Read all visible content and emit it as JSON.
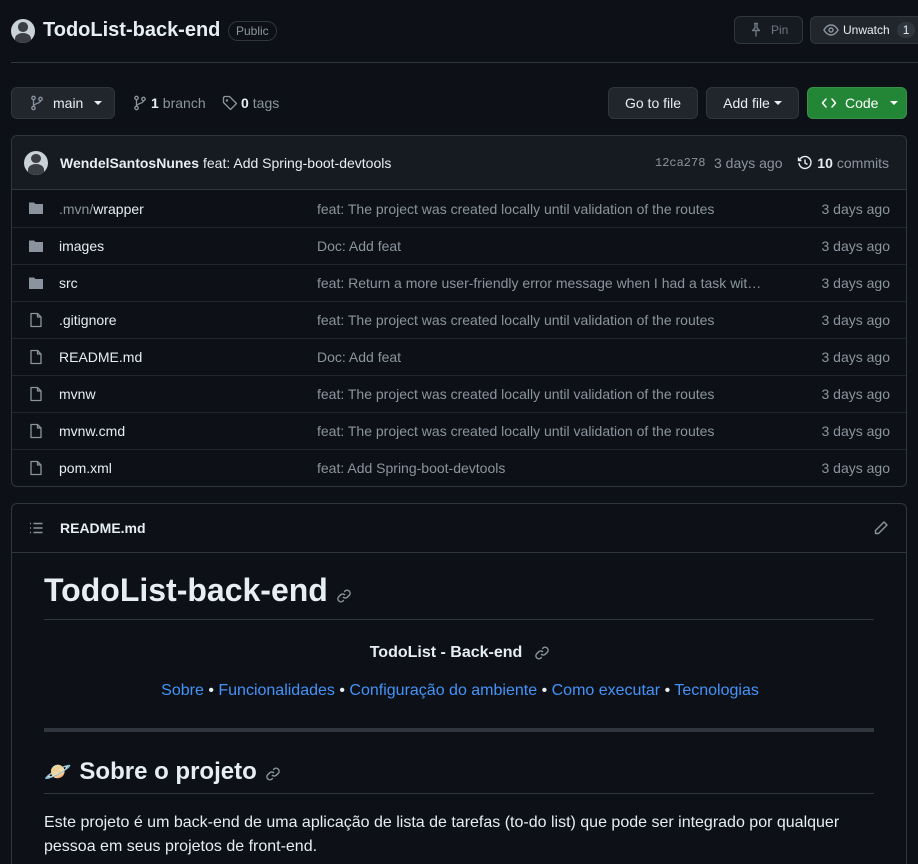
{
  "header": {
    "repo_name": "TodoList-back-end",
    "visibility": "Public",
    "pin_label": "Pin",
    "unwatch_label": "Unwatch",
    "watch_count": "1"
  },
  "toolbar": {
    "branch": "main",
    "branch_count": "1",
    "branch_label": "branch",
    "tag_count": "0",
    "tag_label": "tags",
    "go_to_file": "Go to file",
    "add_file": "Add file",
    "code": "Code"
  },
  "commit": {
    "author": "WendelSantosNunes",
    "message": "feat: Add Spring-boot-devtools",
    "sha": "12ca278",
    "age": "3 days ago",
    "commit_count": "10",
    "commits_label": "commits"
  },
  "files": [
    {
      "prefix": ".mvn/",
      "name": "wrapper",
      "type": "folder",
      "message": "feat: The project was created locally until validation of the routes",
      "age": "3 days ago"
    },
    {
      "prefix": "",
      "name": "images",
      "type": "folder",
      "message": "Doc: Add feat",
      "age": "3 days ago"
    },
    {
      "prefix": "",
      "name": "src",
      "type": "folder",
      "message": "feat: Return a more user-friendly error message when I had a task wit…",
      "age": "3 days ago"
    },
    {
      "prefix": "",
      "name": ".gitignore",
      "type": "file",
      "message": "feat: The project was created locally until validation of the routes",
      "age": "3 days ago"
    },
    {
      "prefix": "",
      "name": "README.md",
      "type": "file",
      "message": "Doc: Add feat",
      "age": "3 days ago"
    },
    {
      "prefix": "",
      "name": "mvnw",
      "type": "file",
      "message": "feat: The project was created locally until validation of the routes",
      "age": "3 days ago"
    },
    {
      "prefix": "",
      "name": "mvnw.cmd",
      "type": "file",
      "message": "feat: The project was created locally until validation of the routes",
      "age": "3 days ago"
    },
    {
      "prefix": "",
      "name": "pom.xml",
      "type": "file",
      "message": "feat: Add Spring-boot-devtools",
      "age": "3 days ago"
    }
  ],
  "readme": {
    "filename": "README.md",
    "title": "TodoList-back-end",
    "subtitle": "TodoList - Back-end",
    "nav_links": [
      "Sobre",
      "Funcionalidades",
      "Configuração do ambiente",
      "Como executar",
      "Tecnologias"
    ],
    "nav_separator": "•",
    "section_emoji": "🪐",
    "section_title": "Sobre o projeto",
    "paragraph": "Este projeto é um back-end de uma aplicação de lista de tarefas (to-do list) que pode ser integrado por qualquer pessoa em seus projetos de front-end."
  },
  "colors": {
    "background": "#0d1117",
    "border": "#30363d",
    "link": "#4493f8",
    "code_button": "#238636",
    "muted_text": "#8b949e"
  },
  "icons": [
    "pin-icon",
    "eye-icon",
    "branch-icon",
    "tag-icon",
    "code-icon",
    "history-icon",
    "folder-icon",
    "file-icon",
    "list-icon",
    "pencil-icon",
    "anchor-link-icon"
  ]
}
